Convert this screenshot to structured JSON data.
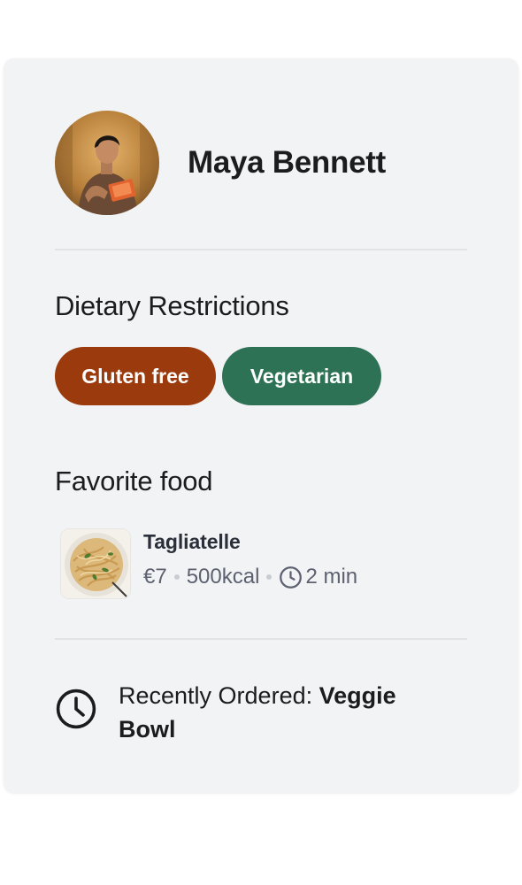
{
  "user": {
    "name": "Maya Bennett"
  },
  "dietary": {
    "title": "Dietary Restrictions",
    "tags": [
      {
        "label": "Gluten free",
        "color": "#9b3a0c"
      },
      {
        "label": "Vegetarian",
        "color": "#2e7256"
      }
    ]
  },
  "favorite": {
    "title": "Favorite food",
    "item": {
      "name": "Tagliatelle",
      "price": "€7",
      "calories": "500kcal",
      "time": "2 min"
    }
  },
  "recent": {
    "prefix": "Recently Ordered: ",
    "item": "Veggie Bowl"
  },
  "icons": {
    "time": "clock-icon"
  },
  "colors": {
    "card_bg": "#f2f3f5",
    "text": "#1b1c1e",
    "muted": "#5d6170"
  }
}
